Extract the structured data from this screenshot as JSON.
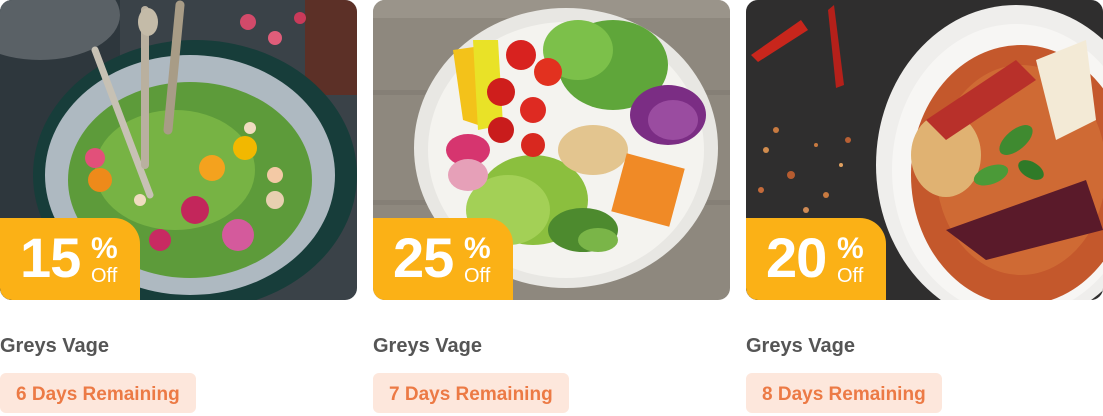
{
  "cards": [
    {
      "image": "green-salad-bowl-photo",
      "discount_value": "15",
      "discount_percent_sign": "%",
      "discount_off": "Off",
      "title": "Greys Vage",
      "remaining": "6 Days Remaining"
    },
    {
      "image": "buddha-bowl-photo",
      "discount_value": "25",
      "discount_percent_sign": "%",
      "discount_off": "Off",
      "title": "Greys Vage",
      "remaining": "7 Days Remaining"
    },
    {
      "image": "curry-bowl-photo",
      "discount_value": "20",
      "discount_percent_sign": "%",
      "discount_off": "Off",
      "title": "Greys Vage",
      "remaining": "8 Days Remaining"
    }
  ],
  "colors": {
    "badge": "#fbb116",
    "badge_text": "#ffffff",
    "title": "#555555",
    "remaining_bg": "#fde7dc",
    "remaining_text": "#ec7a45"
  }
}
